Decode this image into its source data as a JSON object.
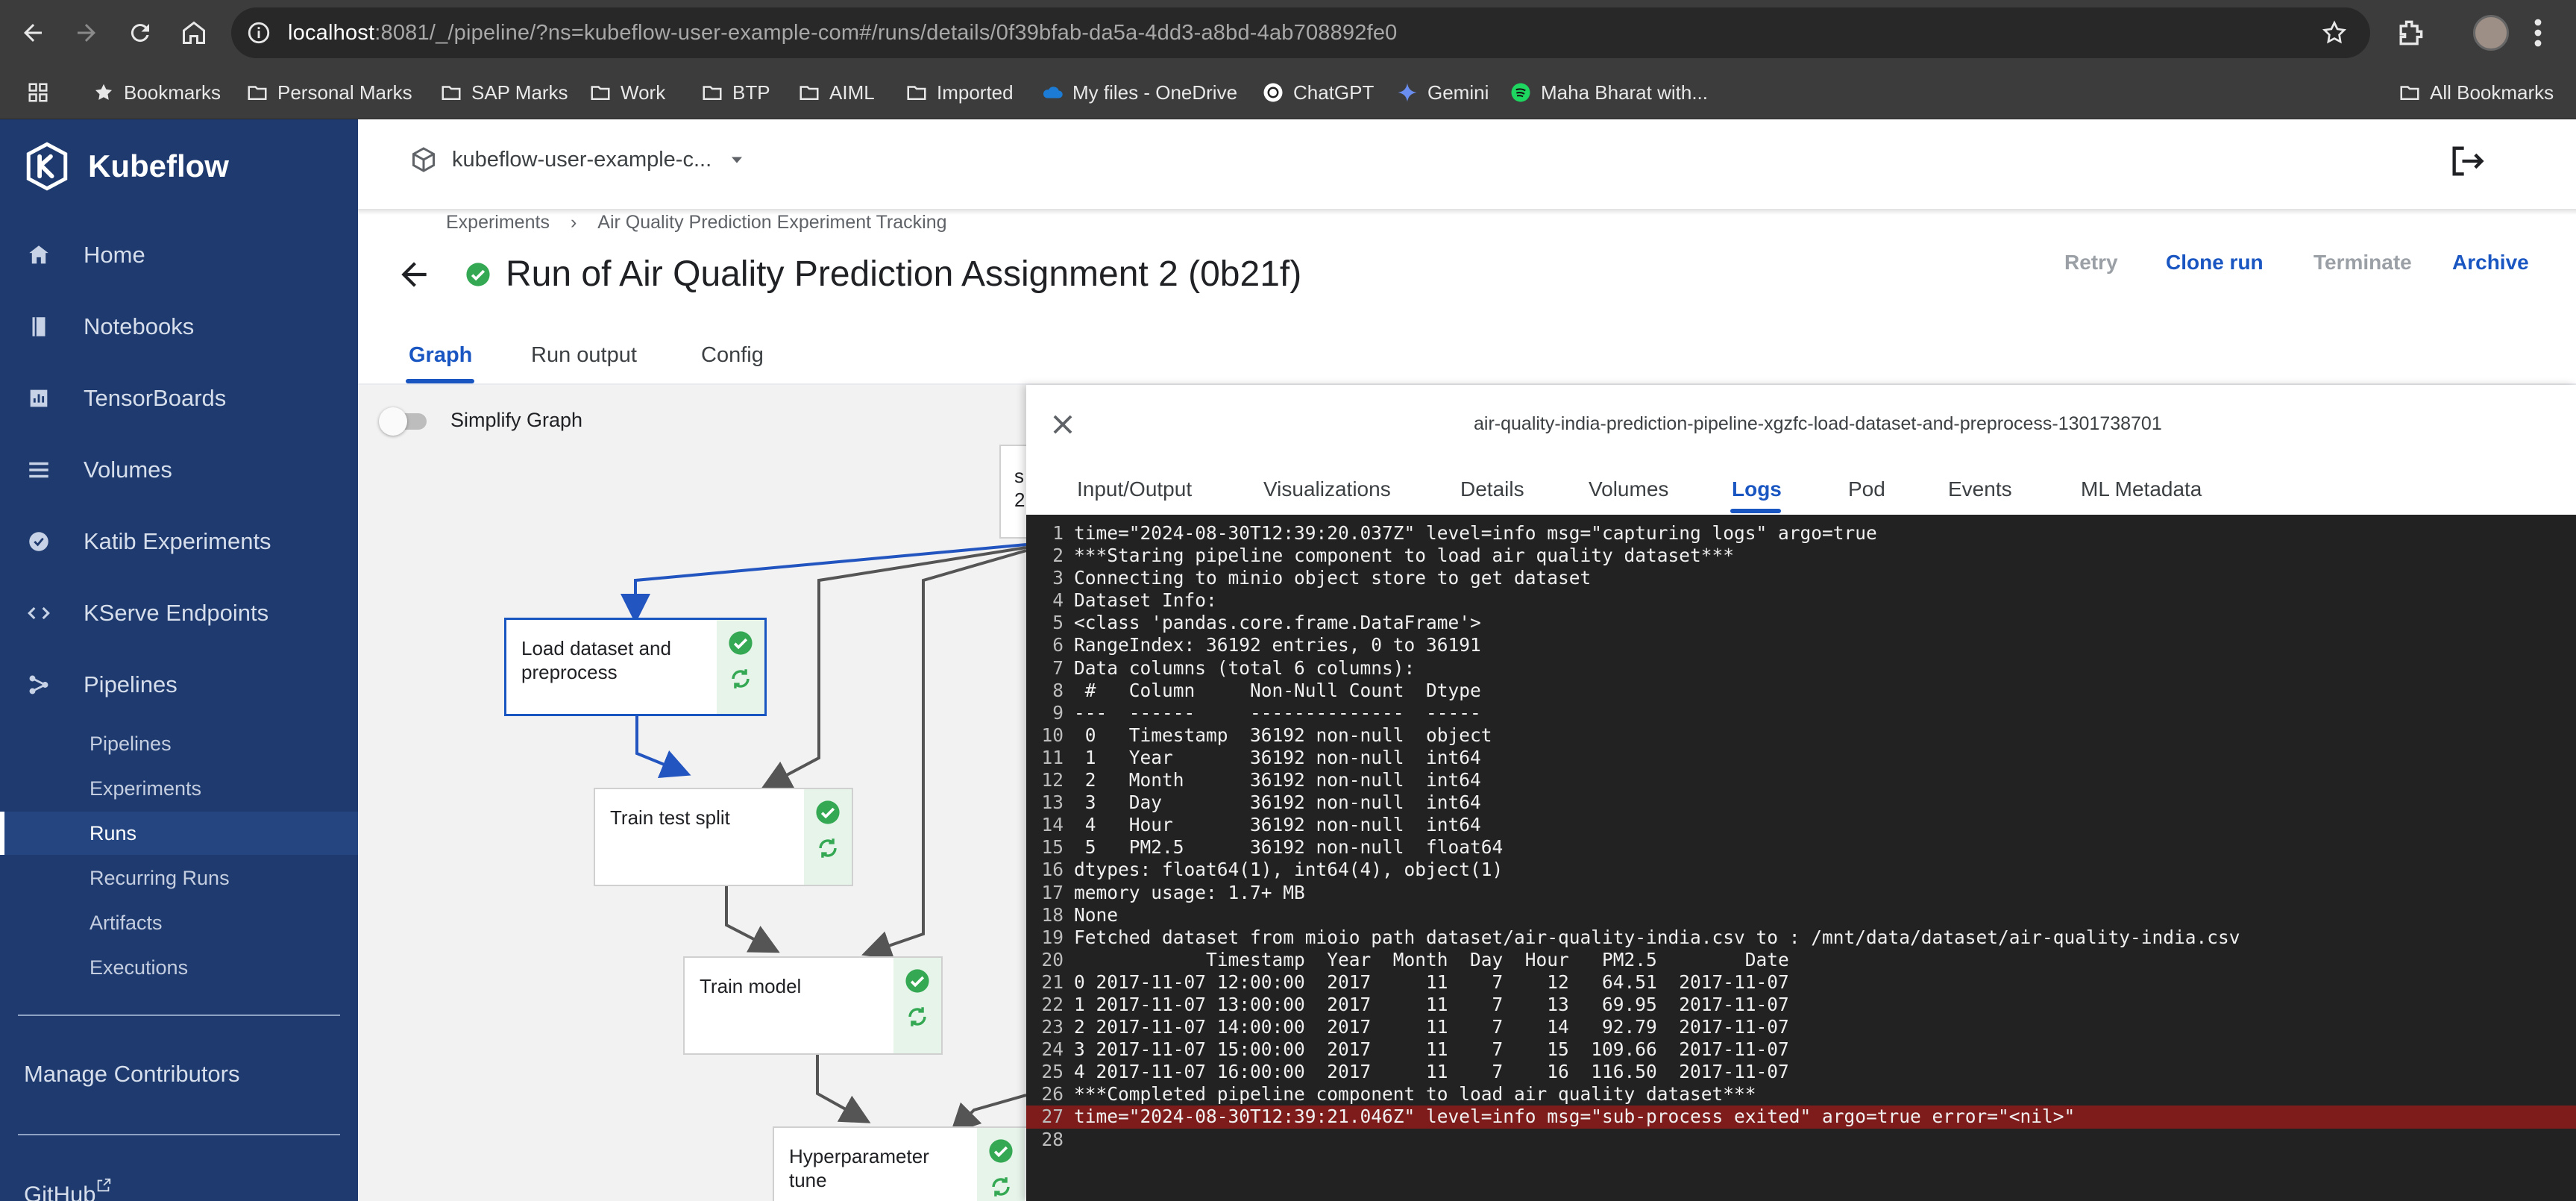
{
  "browser": {
    "url_host": "localhost",
    "url_rest": ":8081/_/pipeline/?ns=kubeflow-user-example-com#/runs/details/0f39bfab-da5a-4dd3-a8bd-4ab708892fe0",
    "bookmarks": [
      {
        "label": "Bookmarks",
        "icon": "star-icon"
      },
      {
        "label": "Personal Marks",
        "icon": "folder-icon"
      },
      {
        "label": "SAP Marks",
        "icon": "folder-icon"
      },
      {
        "label": "Work",
        "icon": "folder-icon"
      },
      {
        "label": "BTP",
        "icon": "folder-icon"
      },
      {
        "label": "AIML",
        "icon": "folder-icon"
      },
      {
        "label": "Imported",
        "icon": "folder-icon"
      },
      {
        "label": "My files - OneDrive",
        "icon": "onedrive-icon"
      },
      {
        "label": "ChatGPT",
        "icon": "chatgpt-icon"
      },
      {
        "label": "Gemini",
        "icon": "gemini-icon"
      },
      {
        "label": "Maha Bharat with...",
        "icon": "spotify-icon"
      }
    ],
    "all_bookmarks": "All Bookmarks"
  },
  "sidebar": {
    "logo": "Kubeflow",
    "items": [
      {
        "label": "Home",
        "icon": "home-icon"
      },
      {
        "label": "Notebooks",
        "icon": "notebook-icon"
      },
      {
        "label": "TensorBoards",
        "icon": "chart-icon"
      },
      {
        "label": "Volumes",
        "icon": "list-icon"
      },
      {
        "label": "Katib Experiments",
        "icon": "katib-icon"
      },
      {
        "label": "KServe Endpoints",
        "icon": "code-icon"
      },
      {
        "label": "Pipelines",
        "icon": "pipeline-icon"
      }
    ],
    "sub_items": [
      "Pipelines",
      "Experiments",
      "Runs",
      "Recurring Runs",
      "Artifacts",
      "Executions"
    ],
    "active_sub": "Runs",
    "manage_contributors": "Manage Contributors",
    "github": "GitHub"
  },
  "header": {
    "namespace": "kubeflow-user-example-c...",
    "breadcrumb": [
      "Experiments",
      "Air Quality Prediction Experiment Tracking"
    ],
    "title": "Run of Air Quality Prediction Assignment 2 (0b21f)",
    "buttons": {
      "retry": "Retry",
      "clone": "Clone run",
      "terminate": "Terminate",
      "archive": "Archive"
    },
    "tabs": [
      "Graph",
      "Run output",
      "Config"
    ]
  },
  "graph": {
    "simplify_label": "Simplify Graph",
    "partial_node_text": "s\n2",
    "nodes": [
      {
        "label": "Load dataset and\npreprocess",
        "status": "succeeded",
        "selected": true
      },
      {
        "label": "Train test split",
        "status": "succeeded"
      },
      {
        "label": "Train model",
        "status": "succeeded"
      },
      {
        "label": "Hyperparameter\ntune",
        "status": "succeeded"
      }
    ]
  },
  "detail": {
    "pod_name": "air-quality-india-prediction-pipeline-xgzfc-load-dataset-and-preprocess-1301738701",
    "tabs": [
      "Input/Output",
      "Visualizations",
      "Details",
      "Volumes",
      "Logs",
      "Pod",
      "Events",
      "ML Metadata"
    ],
    "active_tab": "Logs",
    "error_line": 27,
    "logs": [
      "time=\"2024-08-30T12:39:20.037Z\" level=info msg=\"capturing logs\" argo=true",
      "***Staring pipeline component to load air quality dataset***",
      "Connecting to minio object store to get dataset",
      "Dataset Info:",
      "<class 'pandas.core.frame.DataFrame'>",
      "RangeIndex: 36192 entries, 0 to 36191",
      "Data columns (total 6 columns):",
      " #   Column     Non-Null Count  Dtype ",
      "---  ------     --------------  ----- ",
      " 0   Timestamp  36192 non-null  object",
      " 1   Year       36192 non-null  int64 ",
      " 2   Month      36192 non-null  int64 ",
      " 3   Day        36192 non-null  int64 ",
      " 4   Hour       36192 non-null  int64 ",
      " 5   PM2.5      36192 non-null  float64",
      "dtypes: float64(1), int64(4), object(1)",
      "memory usage: 1.7+ MB",
      "None",
      "Fetched dataset from mioio path dataset/air-quality-india.csv to : /mnt/data/dataset/air-quality-india.csv",
      "            Timestamp  Year  Month  Day  Hour   PM2.5        Date",
      "0 2017-11-07 12:00:00  2017     11    7    12   64.51  2017-11-07",
      "1 2017-11-07 13:00:00  2017     11    7    13   69.95  2017-11-07",
      "2 2017-11-07 14:00:00  2017     11    7    14   92.79  2017-11-07",
      "3 2017-11-07 15:00:00  2017     11    7    15  109.66  2017-11-07",
      "4 2017-11-07 16:00:00  2017     11    7    16  116.50  2017-11-07",
      "***Completed pipeline component to load air quality dataset***",
      "time=\"2024-08-30T12:39:21.046Z\" level=info msg=\"sub-process exited\" argo=true error=\"<nil>\"",
      ""
    ]
  },
  "colors": {
    "sidebar_bg": "#1e3a6e",
    "accent": "#1a56c2",
    "success": "#34a853",
    "log_bg": "#222222",
    "error_line_bg": "#7e1b1b"
  }
}
